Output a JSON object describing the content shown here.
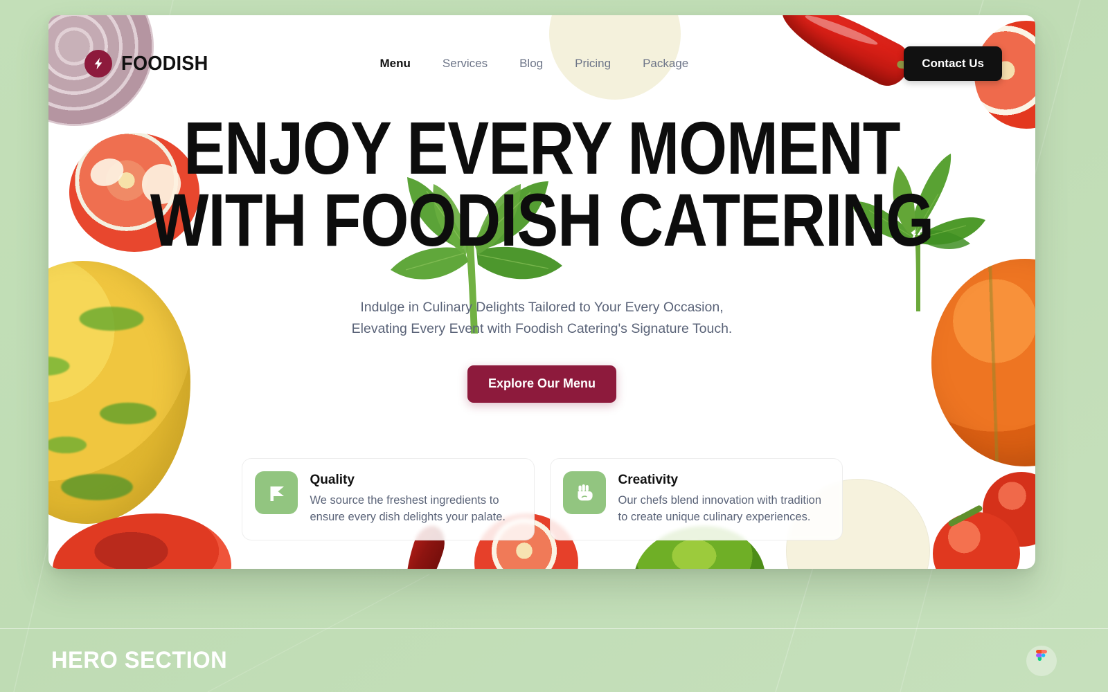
{
  "page": {
    "section_label": "HERO SECTION",
    "badge_icon": "figma-logo-icon",
    "background_color": "#c2debb",
    "accent_color": "#8d1a3c",
    "icon_tile_color": "#92c580",
    "muted_text_color": "#5a6378"
  },
  "header": {
    "logo": {
      "text": "FOODISH",
      "mark_icon": "lightning-bolt-icon",
      "mark_color": "#8d1a3c"
    },
    "nav": [
      {
        "label": "Menu",
        "active": true
      },
      {
        "label": "Services",
        "active": false
      },
      {
        "label": "Blog",
        "active": false
      },
      {
        "label": "Pricing",
        "active": false
      },
      {
        "label": "Package",
        "active": false
      }
    ],
    "contact_button": "Contact Us"
  },
  "hero": {
    "title_line1": "ENJOY EVERY MOMENT",
    "title_line2": "WITH FOODISH CATERING",
    "subtitle_line1": "Indulge in Culinary Delights Tailored to Your Every Occasion,",
    "subtitle_line2": "Elevating Every Event with Foodish Catering's Signature Touch.",
    "cta_label": "Explore Our Menu"
  },
  "features": [
    {
      "icon": "flag-banner-icon",
      "title": "Quality",
      "desc_line1": "We source the freshest ingredients to",
      "desc_line2": "ensure every dish delights your palate."
    },
    {
      "icon": "raised-fist-icon",
      "title": "Creativity",
      "desc_line1": "Our chefs blend innovation with tradition",
      "desc_line2": "to create unique culinary experiences."
    }
  ],
  "decorations": [
    {
      "name": "red-onion-slice",
      "position": "top-left"
    },
    {
      "name": "tomato-slice",
      "position": "left-upper"
    },
    {
      "name": "patty-pan-squash",
      "position": "left-middle"
    },
    {
      "name": "zucchini-slice",
      "position": "top-center"
    },
    {
      "name": "red-chili-pepper",
      "position": "top-right"
    },
    {
      "name": "tomato-cut",
      "position": "top-right-edge"
    },
    {
      "name": "parsley-sprig",
      "position": "right-of-headline"
    },
    {
      "name": "parsley-cluster",
      "position": "over-headline"
    },
    {
      "name": "orange-pumpkin",
      "position": "right-edge"
    },
    {
      "name": "red-pepper-slice",
      "position": "bottom-left"
    },
    {
      "name": "dark-chili",
      "position": "bottom-center-left"
    },
    {
      "name": "tomato-slice",
      "position": "bottom-center"
    },
    {
      "name": "green-pepper",
      "position": "bottom-center-right"
    },
    {
      "name": "zucchini-slice",
      "position": "bottom-right"
    },
    {
      "name": "tomato-cluster",
      "position": "bottom-right-edge"
    }
  ]
}
